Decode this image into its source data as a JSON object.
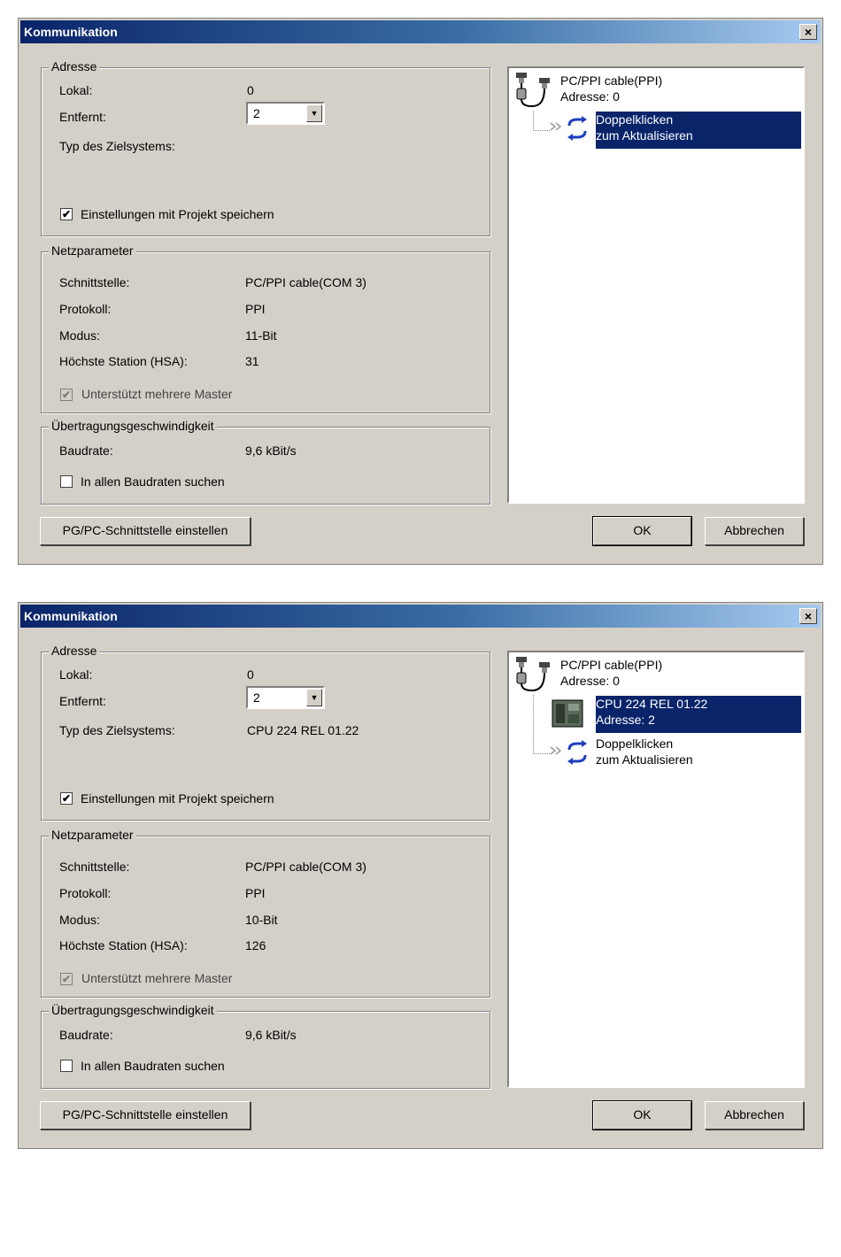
{
  "dialogs": [
    {
      "title": "Kommunikation",
      "close_label": "×",
      "adresse": {
        "legend": "Adresse",
        "lokal_label": "Lokal:",
        "lokal_value": "0",
        "entfernt_label": "Entfernt:",
        "entfernt_value": "2",
        "typ_label": "Typ des Zielsystems:",
        "typ_value": "",
        "save_label": "Einstellungen mit Projekt speichern"
      },
      "netz": {
        "legend": "Netzparameter",
        "schnittstelle_label": "Schnittstelle:",
        "schnittstelle_value": "PC/PPI cable(COM 3)",
        "protokoll_label": "Protokoll:",
        "protokoll_value": "PPI",
        "modus_label": "Modus:",
        "modus_value": "11-Bit",
        "hsa_label": "Höchste Station (HSA):",
        "hsa_value": "31",
        "master_label": "Unterstützt mehrere Master"
      },
      "ueber": {
        "legend": "Übertragungsgeschwindigkeit",
        "baud_label": "Baudrate:",
        "baud_value": "9,6 kBit/s",
        "search_label": "In allen Baudraten suchen"
      },
      "tree": {
        "root_name": "PC/PPI cable(PPI)",
        "root_sub": "Adresse: 0",
        "refresh_name": "Doppelklicken",
        "refresh_sub": "zum Aktualisieren"
      },
      "buttons": {
        "pgpc": "PG/PC-Schnittstelle einstellen",
        "ok": "OK",
        "cancel": "Abbrechen"
      }
    },
    {
      "title": "Kommunikation",
      "close_label": "×",
      "adresse": {
        "legend": "Adresse",
        "lokal_label": "Lokal:",
        "lokal_value": "0",
        "entfernt_label": "Entfernt:",
        "entfernt_value": "2",
        "typ_label": "Typ des Zielsystems:",
        "typ_value": "CPU 224 REL 01.22",
        "save_label": "Einstellungen mit Projekt speichern"
      },
      "netz": {
        "legend": "Netzparameter",
        "schnittstelle_label": "Schnittstelle:",
        "schnittstelle_value": "PC/PPI cable(COM 3)",
        "protokoll_label": "Protokoll:",
        "protokoll_value": "PPI",
        "modus_label": "Modus:",
        "modus_value": "10-Bit",
        "hsa_label": "Höchste Station (HSA):",
        "hsa_value": "126",
        "master_label": "Unterstützt mehrere Master"
      },
      "ueber": {
        "legend": "Übertragungsgeschwindigkeit",
        "baud_label": "Baudrate:",
        "baud_value": "9,6 kBit/s",
        "search_label": "In allen Baudraten suchen"
      },
      "tree": {
        "root_name": "PC/PPI cable(PPI)",
        "root_sub": "Adresse: 0",
        "cpu_name": "CPU 224 REL 01.22",
        "cpu_sub": "Adresse: 2",
        "refresh_name": "Doppelklicken",
        "refresh_sub": "zum Aktualisieren"
      },
      "buttons": {
        "pgpc": "PG/PC-Schnittstelle einstellen",
        "ok": "OK",
        "cancel": "Abbrechen"
      }
    }
  ],
  "colors": {
    "selection": "#0a246a",
    "dialog_bg": "#d4d0c8",
    "title_start": "#0a246a",
    "title_end": "#a6caf0",
    "refresh_icon": "#1f3fbf"
  },
  "icons": {
    "cable": "ppi-cable-icon",
    "cpu": "cpu-module-icon",
    "refresh": "refresh-icon",
    "checkmark": "✔",
    "dropdown": "▼"
  }
}
